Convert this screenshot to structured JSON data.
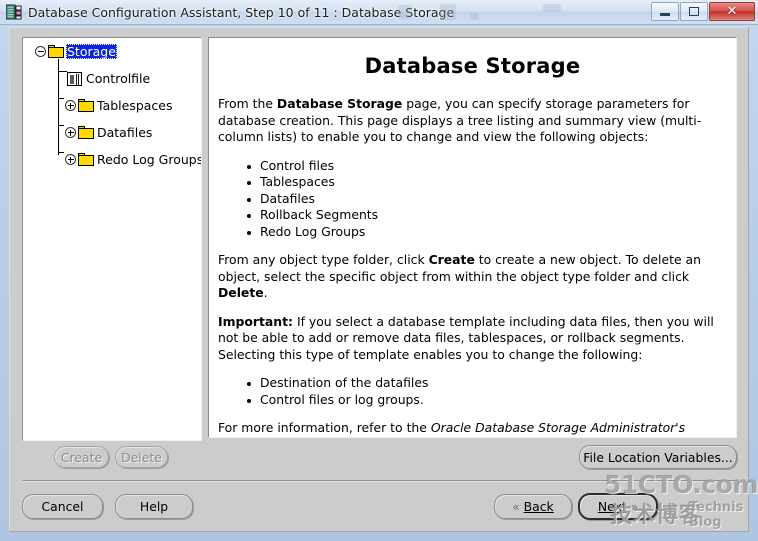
{
  "window": {
    "title": "Database Configuration Assistant, Step 10 of 11 : Database Storage",
    "icon": "database-app-icon",
    "controls": {
      "minimize": "–",
      "maximize": "□",
      "close": "✕"
    }
  },
  "tree": {
    "nodes": [
      {
        "label": "Storage",
        "icon": "folder-icon",
        "expander": "minus-expander-icon",
        "selected": true,
        "depth": 0
      },
      {
        "label": "Controlfile",
        "icon": "controlfile-icon",
        "expander": "none",
        "selected": false,
        "depth": 1
      },
      {
        "label": "Tablespaces",
        "icon": "folder-icon",
        "expander": "plus-expander-icon",
        "selected": false,
        "depth": 1
      },
      {
        "label": "Datafiles",
        "icon": "folder-icon",
        "expander": "plus-expander-icon",
        "selected": false,
        "depth": 1
      },
      {
        "label": "Redo Log Groups",
        "icon": "folder-icon",
        "expander": "plus-expander-icon",
        "selected": false,
        "depth": 1
      }
    ]
  },
  "content": {
    "title": "Database Storage",
    "paragraph1_prefix": "From the ",
    "paragraph1_bold": "Database Storage",
    "paragraph1_suffix": " page, you can specify storage parameters for database creation. This page displays a tree listing and summary view (multi-column lists) to enable you to change and view the following objects:",
    "object_list": [
      "Control files",
      "Tablespaces",
      "Datafiles",
      "Rollback Segments",
      "Redo Log Groups"
    ],
    "paragraph2_part1": "From any object type folder, click ",
    "paragraph2_bold1": "Create",
    "paragraph2_part2": " to create a new object. To delete an object, select the specific object from within the object type folder and click ",
    "paragraph2_bold2": "Delete",
    "paragraph2_part3": ".",
    "paragraph3_bold": "Important:",
    "paragraph3_text": " If you select a database template including data files, then you will not be able to add or remove data files, tablespaces, or rollback segments. Selecting this type of template enables you to change the following:",
    "change_list": [
      "Destination of the datafiles",
      "Control files or log groups."
    ],
    "paragraph4_prefix": "For more information, refer to the ",
    "paragraph4_italic": "Oracle Database Storage Administrator's Guide",
    "paragraph4_suffix": "."
  },
  "buttons": {
    "create": "Create",
    "delete": "Delete",
    "file_location_variables": "File Location Variables...",
    "cancel": "Cancel",
    "help": "Help",
    "back": "Back",
    "back_chevron": "«",
    "next": "Next",
    "next_chevron": "»"
  },
  "watermark": {
    "line1": "51CTO.com",
    "line2": "技术博客",
    "line3": "Technis Blog"
  },
  "colors": {
    "selection_blue": "#0b24d6",
    "folder_yellow": "#ffd900",
    "client_gray": "#cccccc",
    "panel_white": "#ffffff",
    "close_red": "#bd2f28"
  }
}
